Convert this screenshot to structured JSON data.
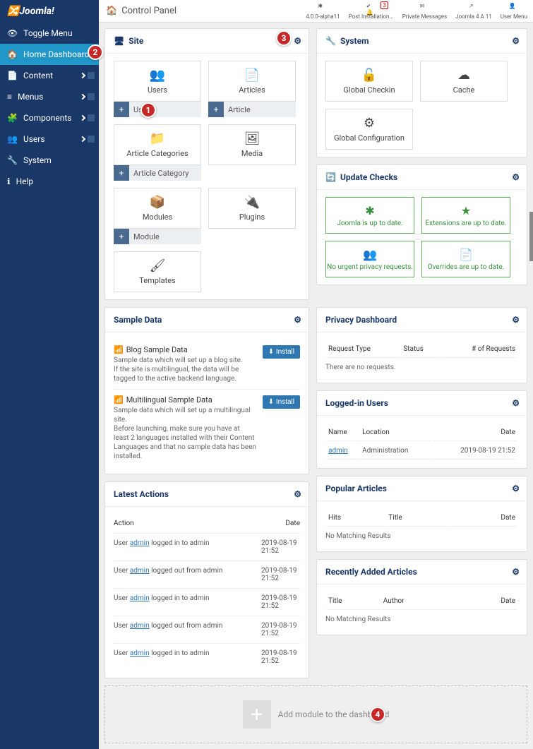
{
  "top": {
    "brand": "Joomla!",
    "title": "Control Panel",
    "icons": [
      {
        "label": "4.0.0-alpha11",
        "name": "joomla-icon"
      },
      {
        "label": "Post Installation...",
        "name": "check-bell-icon",
        "badge": "3"
      },
      {
        "label": "Private Messages",
        "name": "mail-icon"
      },
      {
        "label": "Joomla 4 A 11",
        "name": "external-icon"
      },
      {
        "label": "User Menu",
        "name": "user-icon"
      }
    ]
  },
  "sidebar": [
    {
      "label": "Toggle Menu",
      "icon": "eye-icon",
      "active": false,
      "expandable": false
    },
    {
      "label": "Home Dashboard",
      "icon": "home-icon",
      "active": true,
      "expandable": false
    },
    {
      "label": "Content",
      "icon": "file-icon",
      "active": false,
      "expandable": true
    },
    {
      "label": "Menus",
      "icon": "list-icon",
      "active": false,
      "expandable": true
    },
    {
      "label": "Components",
      "icon": "puzzle-icon",
      "active": false,
      "expandable": true
    },
    {
      "label": "Users",
      "icon": "users-icon",
      "active": false,
      "expandable": true
    },
    {
      "label": "System",
      "icon": "wrench-icon",
      "active": false,
      "expandable": false
    },
    {
      "label": "Help",
      "icon": "info-icon",
      "active": false,
      "expandable": false
    }
  ],
  "site": {
    "title": "Site",
    "tiles": [
      {
        "label": "Users",
        "quick": "User"
      },
      {
        "label": "Articles",
        "quick": "Article"
      },
      {
        "label": "Article Categories",
        "quick": "Article Category"
      },
      {
        "label": "Media"
      },
      {
        "label": "Modules",
        "quick": "Module"
      },
      {
        "label": "Plugins"
      },
      {
        "label": "Templates"
      }
    ]
  },
  "system": {
    "title": "System",
    "tiles": [
      {
        "label": "Global Checkin"
      },
      {
        "label": "Cache"
      },
      {
        "label": "Global Configuration"
      }
    ]
  },
  "updates": {
    "title": "Update Checks",
    "items": [
      "Joomla is up to date.",
      "Extensions are up to date.",
      "No urgent privacy requests.",
      "Overrides are up to date."
    ]
  },
  "sample": {
    "title": "Sample Data",
    "install": "Install",
    "items": [
      {
        "title": "Blog Sample Data",
        "desc": "Sample data which will set up a blog site.\nIf the site is multilingual, the data will be tagged to the active backend language."
      },
      {
        "title": "Multilingual Sample Data",
        "desc": "Sample data which will set up a multilingual site.\nBefore launching, make sure you have at least 2 languages installed with their Content Languages and that no sample data has been installed."
      }
    ]
  },
  "privacy": {
    "title": "Privacy Dashboard",
    "headers": [
      "Request Type",
      "Status",
      "# of Requests"
    ],
    "empty": "There are no requests."
  },
  "logged_in": {
    "title": "Logged-in Users",
    "headers": [
      "Name",
      "Location",
      "Date"
    ],
    "rows": [
      {
        "name": "admin",
        "location": "Administration",
        "date": "2019-08-19 21:52"
      }
    ]
  },
  "latest_actions": {
    "title": "Latest Actions",
    "headers": {
      "action": "Action",
      "date": "Date"
    },
    "rows": [
      {
        "pre": "User ",
        "user": "admin",
        "post": " logged in to admin",
        "date": "2019-08-19 21:52"
      },
      {
        "pre": "User ",
        "user": "admin",
        "post": " logged out from admin",
        "date": "2019-08-19 21:52"
      },
      {
        "pre": "User ",
        "user": "admin",
        "post": " logged in to admin",
        "date": "2019-08-19 21:52"
      },
      {
        "pre": "User ",
        "user": "admin",
        "post": " logged out from admin",
        "date": "2019-08-19 21:52"
      },
      {
        "pre": "User ",
        "user": "admin",
        "post": " logged in to admin",
        "date": "2019-08-19 21:52"
      }
    ]
  },
  "popular": {
    "title": "Popular Articles",
    "headers": [
      "Hits",
      "Title",
      "Date"
    ],
    "empty": "No Matching Results"
  },
  "recent": {
    "title": "Recently Added Articles",
    "headers": [
      "Title",
      "Author",
      "Date"
    ],
    "empty": "No Matching Results"
  },
  "add_module": "Add module to the dashboard",
  "callouts": {
    "1": "1",
    "2": "2",
    "3": "3",
    "4": "4"
  }
}
